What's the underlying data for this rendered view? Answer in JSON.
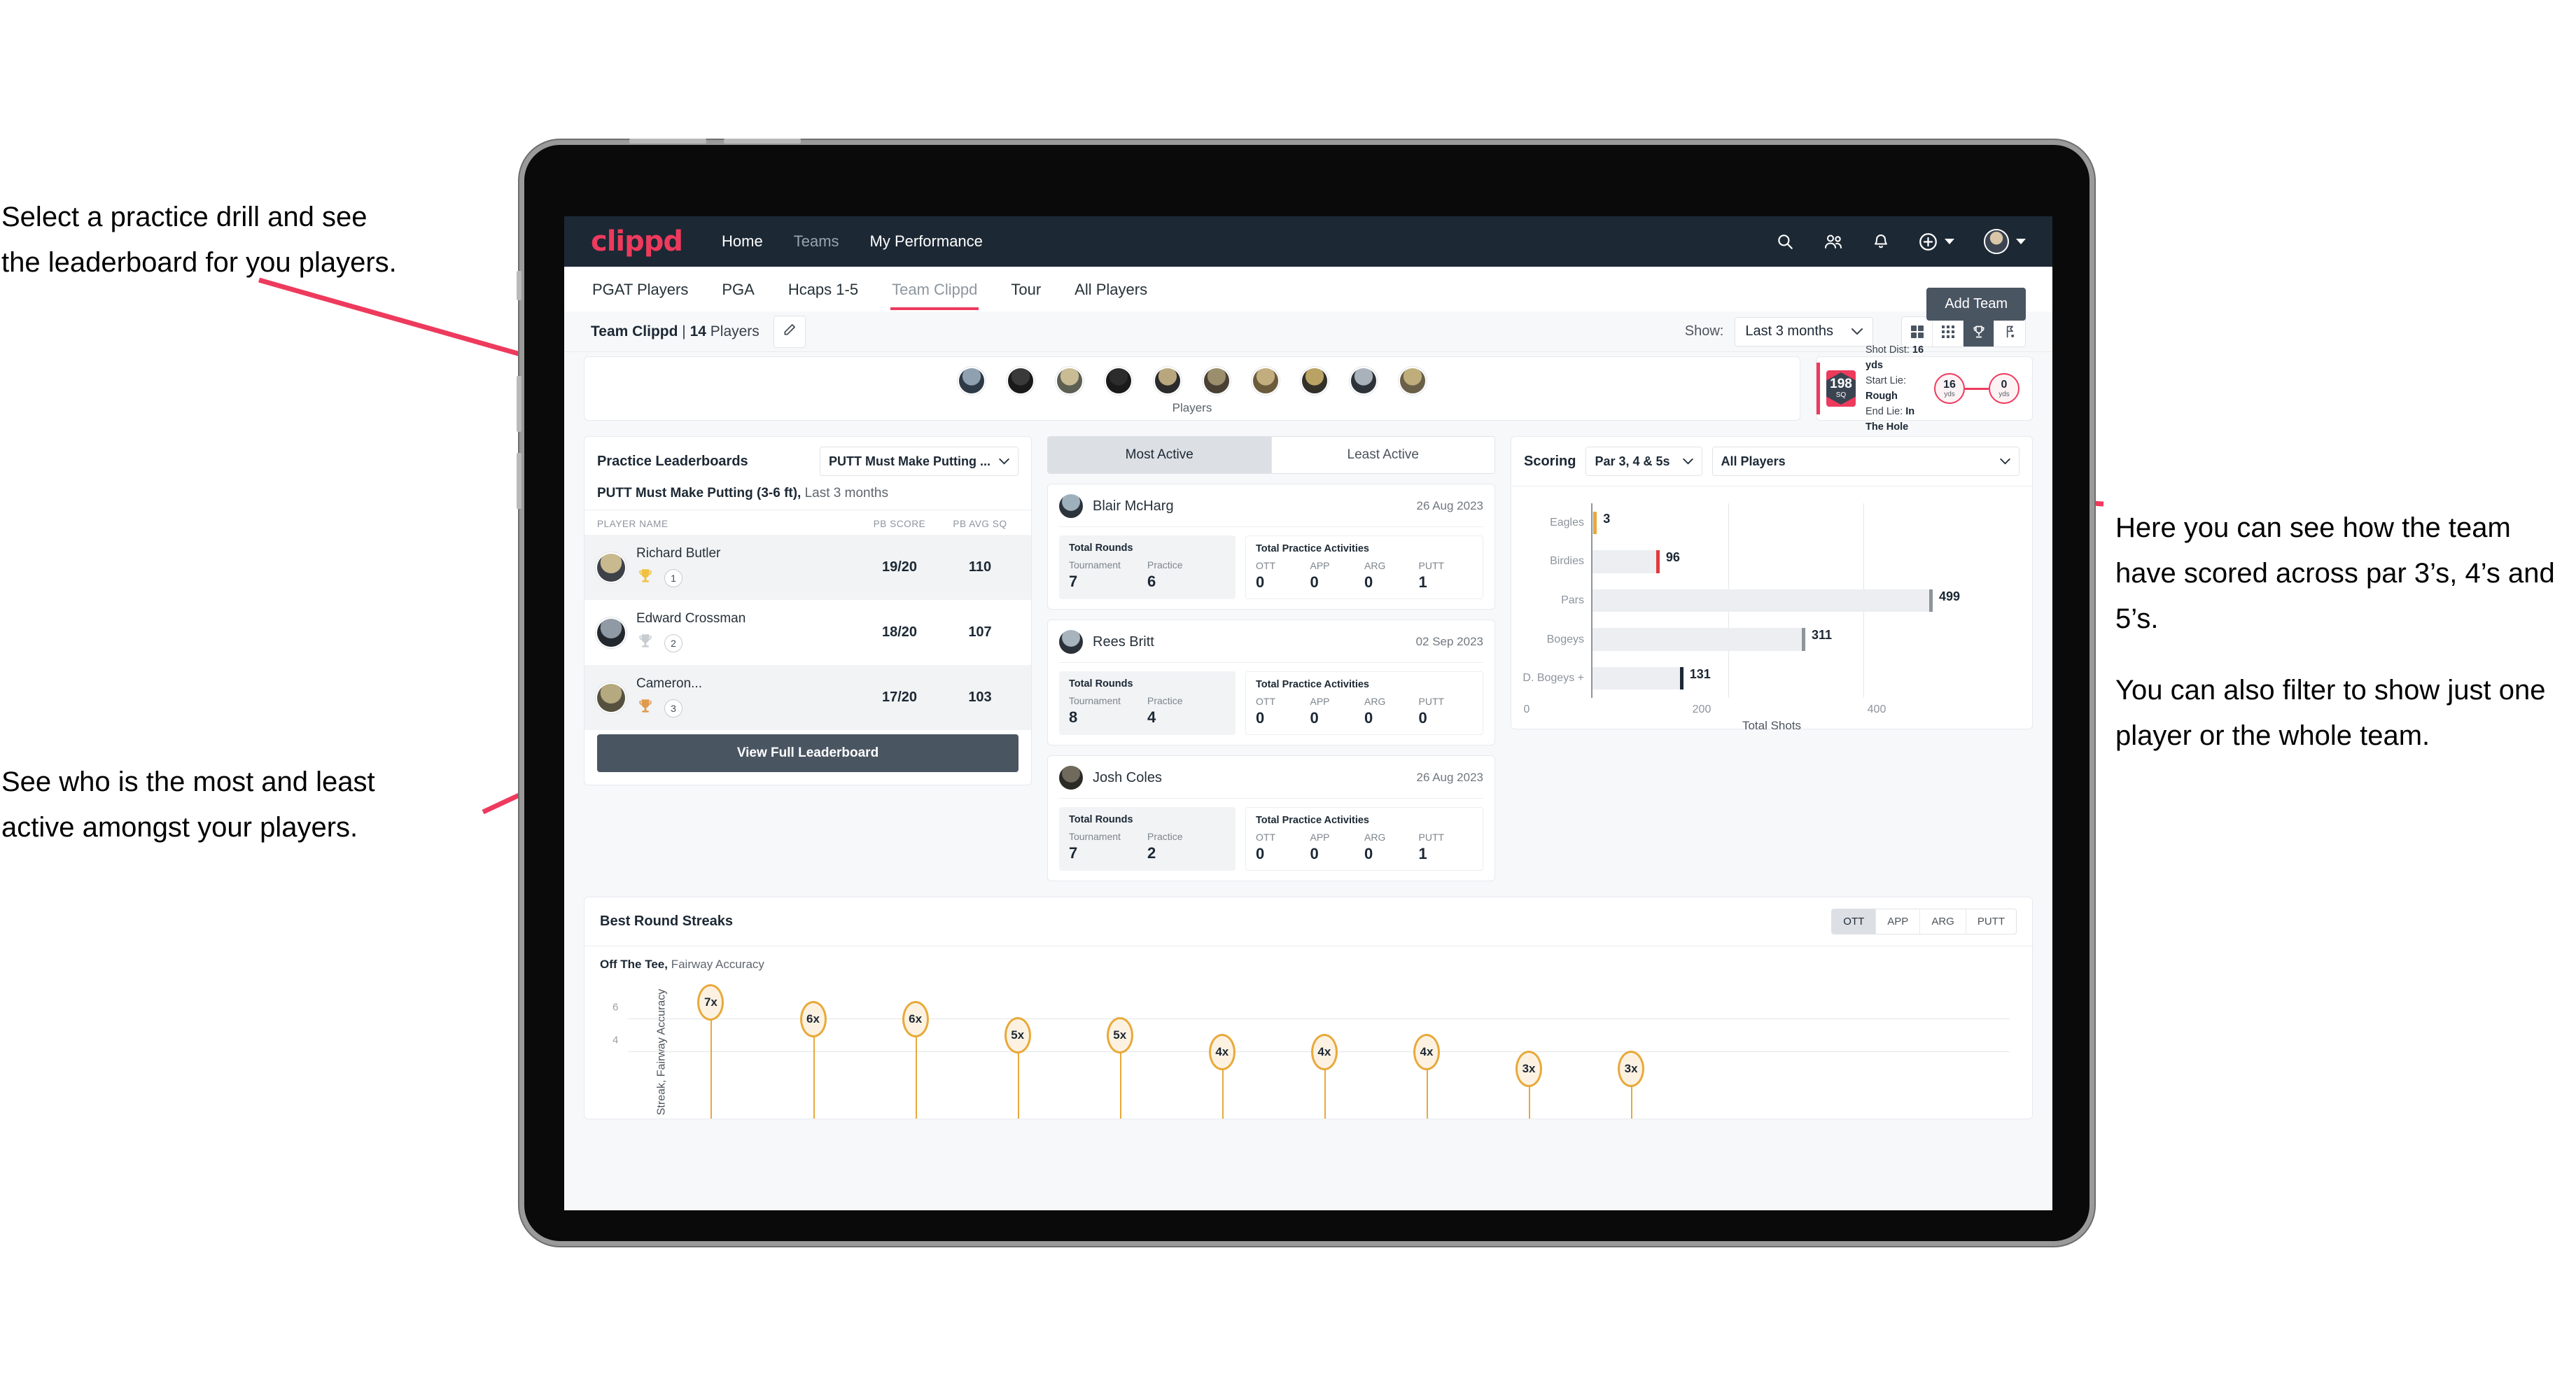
{
  "annotations": {
    "left_top": [
      "Select a practice drill and see",
      "the leaderboard for you players."
    ],
    "left_bottom": [
      "See who is the most and least",
      "active amongst your players."
    ],
    "right": [
      "Here you can see how the team have scored across par 3’s, 4’s and 5’s.",
      "You can also filter to show just one player or the whole team."
    ]
  },
  "app": {
    "logo": "clippd",
    "nav": [
      {
        "label": "Home",
        "dim": false
      },
      {
        "label": "Teams",
        "dim": true
      },
      {
        "label": "My Performance",
        "dim": false
      }
    ],
    "nav_icons": [
      "search-icon",
      "people-icon",
      "bell-icon",
      "plus-circle-icon",
      "avatar"
    ],
    "tabs": [
      {
        "label": "PGAT Players",
        "active": false
      },
      {
        "label": "PGA",
        "active": false
      },
      {
        "label": "Hcaps 1-5",
        "active": false
      },
      {
        "label": "Team Clippd",
        "active": true
      },
      {
        "label": "Tour",
        "active": false
      },
      {
        "label": "All Players",
        "active": false
      }
    ],
    "add_team_label": "Add Team"
  },
  "subheader": {
    "team_name": "Team Clippd",
    "separator": " | ",
    "player_count": "14",
    "players_word": " Players",
    "edit_icon": "pencil-icon",
    "show_label": "Show:",
    "show_value": "Last 3 months",
    "view_modes": [
      {
        "icon": "grid-4-icon",
        "active": false
      },
      {
        "icon": "grid-9-icon",
        "active": false
      },
      {
        "icon": "trophy-icon",
        "active": true
      },
      {
        "icon": "golf-flag-icon",
        "active": false
      }
    ]
  },
  "players_strip": {
    "label": "Players",
    "count": 10
  },
  "shot_card": {
    "sq_value": "198",
    "sq_unit": "SQ",
    "lines": [
      {
        "key": "Shot Dist:",
        "value": "16 yds"
      },
      {
        "key": "Start Lie:",
        "value": "Rough"
      },
      {
        "key": "End Lie:",
        "value": "In The Hole"
      }
    ],
    "start_dist": "16",
    "start_unit": "yds",
    "end_dist": "0",
    "end_unit": "yds"
  },
  "leaderboard": {
    "title": "Practice Leaderboards",
    "drill_select": "PUTT Must Make Putting ...",
    "subtitle_bold": "PUTT Must Make Putting (3-6 ft),",
    "subtitle_rest": " Last 3 months",
    "columns": [
      "PLAYER NAME",
      "PB SCORE",
      "PB AVG SQ"
    ],
    "rows": [
      {
        "name": "Richard Butler",
        "rank": "1",
        "trophy": "gold",
        "pb_score": "19/20",
        "pb_avg_sq": "110"
      },
      {
        "name": "Edward Crossman",
        "rank": "2",
        "trophy": "silver",
        "pb_score": "18/20",
        "pb_avg_sq": "107"
      },
      {
        "name": "Cameron...",
        "rank": "3",
        "trophy": "bronze",
        "pb_score": "17/20",
        "pb_avg_sq": "103"
      }
    ],
    "button": "View Full Leaderboard"
  },
  "activity": {
    "tabs": [
      {
        "label": "Most Active",
        "active": true
      },
      {
        "label": "Least Active",
        "active": false
      }
    ],
    "rounds_title": "Total Rounds",
    "practice_title": "Total Practice Activities",
    "rounds_keys": [
      "Tournament",
      "Practice"
    ],
    "practice_keys": [
      "OTT",
      "APP",
      "ARG",
      "PUTT"
    ],
    "cards": [
      {
        "name": "Blair McHarg",
        "date": "26 Aug 2023",
        "tournament": "7",
        "practice": "6",
        "ott": "0",
        "app": "0",
        "arg": "0",
        "putt": "1"
      },
      {
        "name": "Rees Britt",
        "date": "02 Sep 2023",
        "tournament": "8",
        "practice": "4",
        "ott": "0",
        "app": "0",
        "arg": "0",
        "putt": "0"
      },
      {
        "name": "Josh Coles",
        "date": "26 Aug 2023",
        "tournament": "7",
        "practice": "2",
        "ott": "0",
        "app": "0",
        "arg": "0",
        "putt": "1"
      }
    ]
  },
  "scoring": {
    "title": "Scoring",
    "par_select": "Par 3, 4 & 5s",
    "player_select": "All Players"
  },
  "streaks": {
    "title": "Best Round Streaks",
    "tabs": [
      {
        "label": "OTT",
        "active": true
      },
      {
        "label": "APP",
        "active": false
      },
      {
        "label": "ARG",
        "active": false
      },
      {
        "label": "PUTT",
        "active": false
      }
    ],
    "sub_bold": "Off The Tee,",
    "sub_rest": " Fairway Accuracy"
  },
  "colors": {
    "navy": "#1c2834",
    "pink": "#ee3a5d",
    "slate": "#4a5562",
    "gold": "#e8a93a",
    "page_bg": "#f7f8fa"
  },
  "chart_data": [
    {
      "type": "bar",
      "orientation": "horizontal",
      "title": "Scoring",
      "categories": [
        "Eagles",
        "Birdies",
        "Pars",
        "Bogeys",
        "D. Bogeys +"
      ],
      "values": [
        3,
        96,
        499,
        311,
        131
      ],
      "cap_colors": [
        "#e8a93a",
        "#e03b3b",
        "#8c949c",
        "#8c949c",
        "#1c2834"
      ],
      "xlabel": "Total Shots",
      "ylabel": "",
      "xlim": [
        0,
        560
      ],
      "xticks": [
        0,
        200,
        400
      ],
      "grid": true,
      "legend": "none"
    },
    {
      "type": "scatter",
      "title": "Best Round Streaks",
      "subtitle": "Off The Tee, Fairway Accuracy",
      "ylabel": "Streak, Fairway Accuracy",
      "xlabel": "",
      "values": [
        7,
        6,
        6,
        5,
        5,
        4,
        4,
        4,
        3,
        3
      ],
      "labels": [
        "7x",
        "6x",
        "6x",
        "5x",
        "5x",
        "4x",
        "4x",
        "4x",
        "3x",
        "3x"
      ],
      "yticks": [
        4,
        6
      ],
      "ylim": [
        0,
        8
      ],
      "grid": true,
      "marker_color": "#e8a93a",
      "legend": "none"
    }
  ]
}
